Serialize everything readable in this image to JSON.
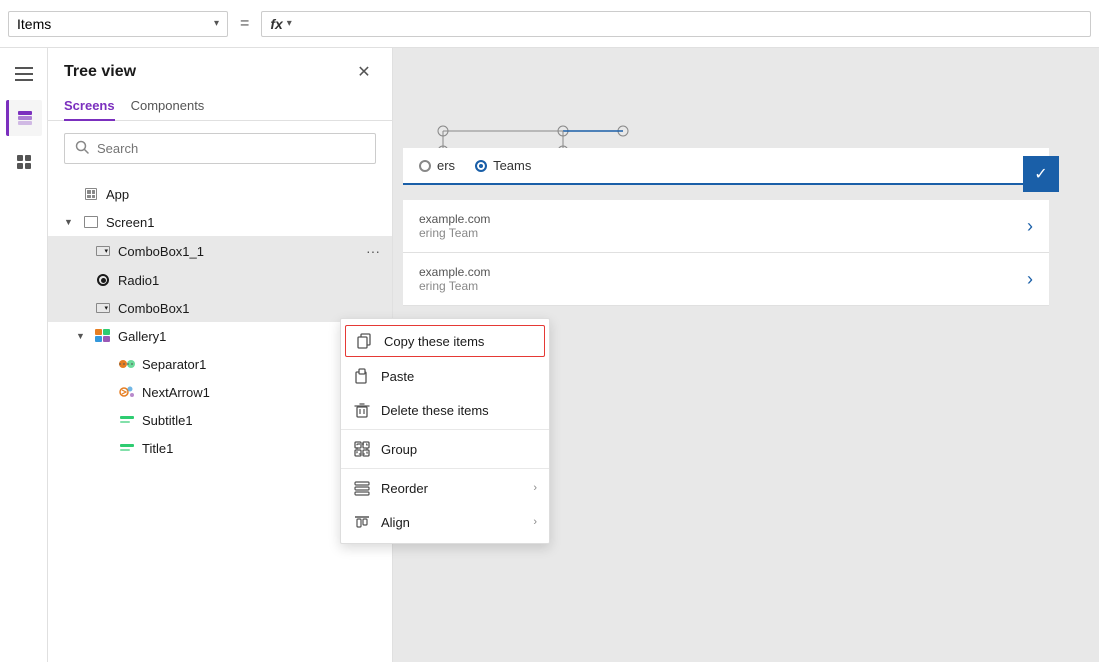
{
  "topbar": {
    "items_label": "Items",
    "items_chevron": "▾",
    "equals_symbol": "=",
    "fx_label": "fx",
    "fx_chevron": "▾"
  },
  "tree_view": {
    "title": "Tree view",
    "close_icon": "✕",
    "tabs": [
      {
        "label": "Screens",
        "active": true
      },
      {
        "label": "Components",
        "active": false
      }
    ],
    "search_placeholder": "Search",
    "items": [
      {
        "id": "app",
        "label": "App",
        "indent": 0,
        "has_expand": false,
        "icon": "app"
      },
      {
        "id": "screen1",
        "label": "Screen1",
        "indent": 0,
        "has_expand": true,
        "expanded": true,
        "icon": "screen"
      },
      {
        "id": "combobox1_1",
        "label": "ComboBox1_1",
        "indent": 1,
        "has_expand": false,
        "icon": "combobox",
        "selected": true,
        "has_dots": true
      },
      {
        "id": "radio1",
        "label": "Radio1",
        "indent": 1,
        "has_expand": false,
        "icon": "radio",
        "selected": true
      },
      {
        "id": "combobox1",
        "label": "ComboBox1",
        "indent": 1,
        "has_expand": false,
        "icon": "combobox",
        "selected": true
      },
      {
        "id": "gallery1",
        "label": "Gallery1",
        "indent": 1,
        "has_expand": true,
        "expanded": true,
        "icon": "gallery"
      },
      {
        "id": "separator1",
        "label": "Separator1",
        "indent": 2,
        "has_expand": false,
        "icon": "separator"
      },
      {
        "id": "nextarrow1",
        "label": "NextArrow1",
        "indent": 2,
        "has_expand": false,
        "icon": "nextarrow"
      },
      {
        "id": "subtitle1",
        "label": "Subtitle1",
        "indent": 2,
        "has_expand": false,
        "icon": "subtitle"
      },
      {
        "id": "title1",
        "label": "Title1",
        "indent": 2,
        "has_expand": false,
        "icon": "title"
      }
    ]
  },
  "context_menu": {
    "items": [
      {
        "id": "copy",
        "label": "Copy these items",
        "icon": "copy",
        "highlighted": true,
        "has_arrow": false
      },
      {
        "id": "paste",
        "label": "Paste",
        "icon": "paste",
        "highlighted": false,
        "has_arrow": false
      },
      {
        "id": "delete",
        "label": "Delete these items",
        "icon": "delete",
        "highlighted": false,
        "has_arrow": false
      },
      {
        "id": "group",
        "label": "Group",
        "icon": "group",
        "highlighted": false,
        "has_arrow": false
      },
      {
        "id": "reorder",
        "label": "Reorder",
        "icon": "reorder",
        "highlighted": false,
        "has_arrow": true
      },
      {
        "id": "align",
        "label": "Align",
        "icon": "align",
        "highlighted": false,
        "has_arrow": true
      }
    ]
  },
  "canvas": {
    "radio_options": [
      {
        "label": "ers",
        "selected": false
      },
      {
        "label": "Teams",
        "selected": true
      }
    ],
    "team_items": [
      {
        "email": "example.com",
        "team": "ering Team"
      },
      {
        "email": "example.com",
        "team": "ering Team"
      }
    ]
  }
}
